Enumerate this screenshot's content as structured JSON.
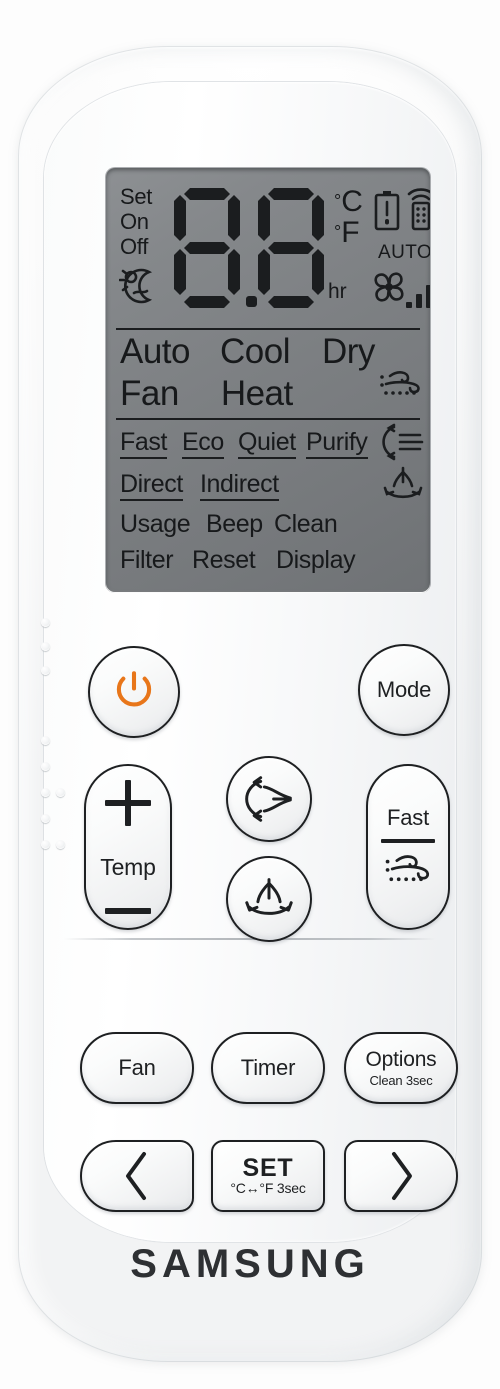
{
  "device": {
    "brand": "SAMSUNG",
    "type": "air-conditioner-remote-control",
    "body_color": "#f7f8f9",
    "accent_color": "#e8761a",
    "lcd_color": "#7c7f82",
    "ink_color": "#1b1d1f"
  },
  "lcd": {
    "status_labels": [
      "Set",
      "On",
      "Off"
    ],
    "sleep_icon": "sleep-moon-sun-icon",
    "digits": {
      "digit1": "8",
      "digit2": "8",
      "decimal_point": "."
    },
    "units": {
      "celsius": "°C",
      "fahrenheit": "°F",
      "hour": "hr"
    },
    "battery_icon": "battery-low-icon",
    "transmit_icon": "remote-transmit-icon",
    "fan_auto_label": "AUTO",
    "fan_blade_icon": "fan-blade-icon",
    "fan_speed_icon": "fan-speed-bars-icon",
    "mode_row_1": [
      "Auto",
      "Cool",
      "Dry"
    ],
    "mode_row_2": [
      "Fan",
      "Heat"
    ],
    "wind_free_icon": "wind-flow-icon",
    "options_row": [
      "Fast",
      "Eco",
      "Quiet",
      "Purify"
    ],
    "purify_icon": "air-purify-swing-icon",
    "direction_row": [
      "Direct",
      "Indirect"
    ],
    "swing_icon": "vertical-swing-icon",
    "utility_row_1": [
      "Usage",
      "Beep",
      "Clean"
    ],
    "utility_row_2": [
      "Filter",
      "Reset",
      "Display"
    ]
  },
  "buttons": {
    "power": {
      "label": "",
      "icon": "power-icon"
    },
    "mode": {
      "label": "Mode"
    },
    "temp": {
      "label": "Temp",
      "increase_icon": "plus-icon",
      "decrease_icon": "minus-icon"
    },
    "swing_horizontal": {
      "label": "",
      "icon": "horizontal-swing-icon"
    },
    "swing_vertical": {
      "label": "",
      "icon": "vertical-swing-icon"
    },
    "fast": {
      "label": "Fast",
      "icon": "wind-flow-icon"
    },
    "fan": {
      "label": "Fan"
    },
    "timer": {
      "label": "Timer"
    },
    "options": {
      "label": "Options",
      "sub_label": "Clean 3sec"
    },
    "previous": {
      "label": "",
      "icon": "chevron-left-icon"
    },
    "set": {
      "label": "SET",
      "sub_label": "°C↔°F 3sec"
    },
    "next": {
      "label": "",
      "icon": "chevron-right-icon"
    }
  }
}
